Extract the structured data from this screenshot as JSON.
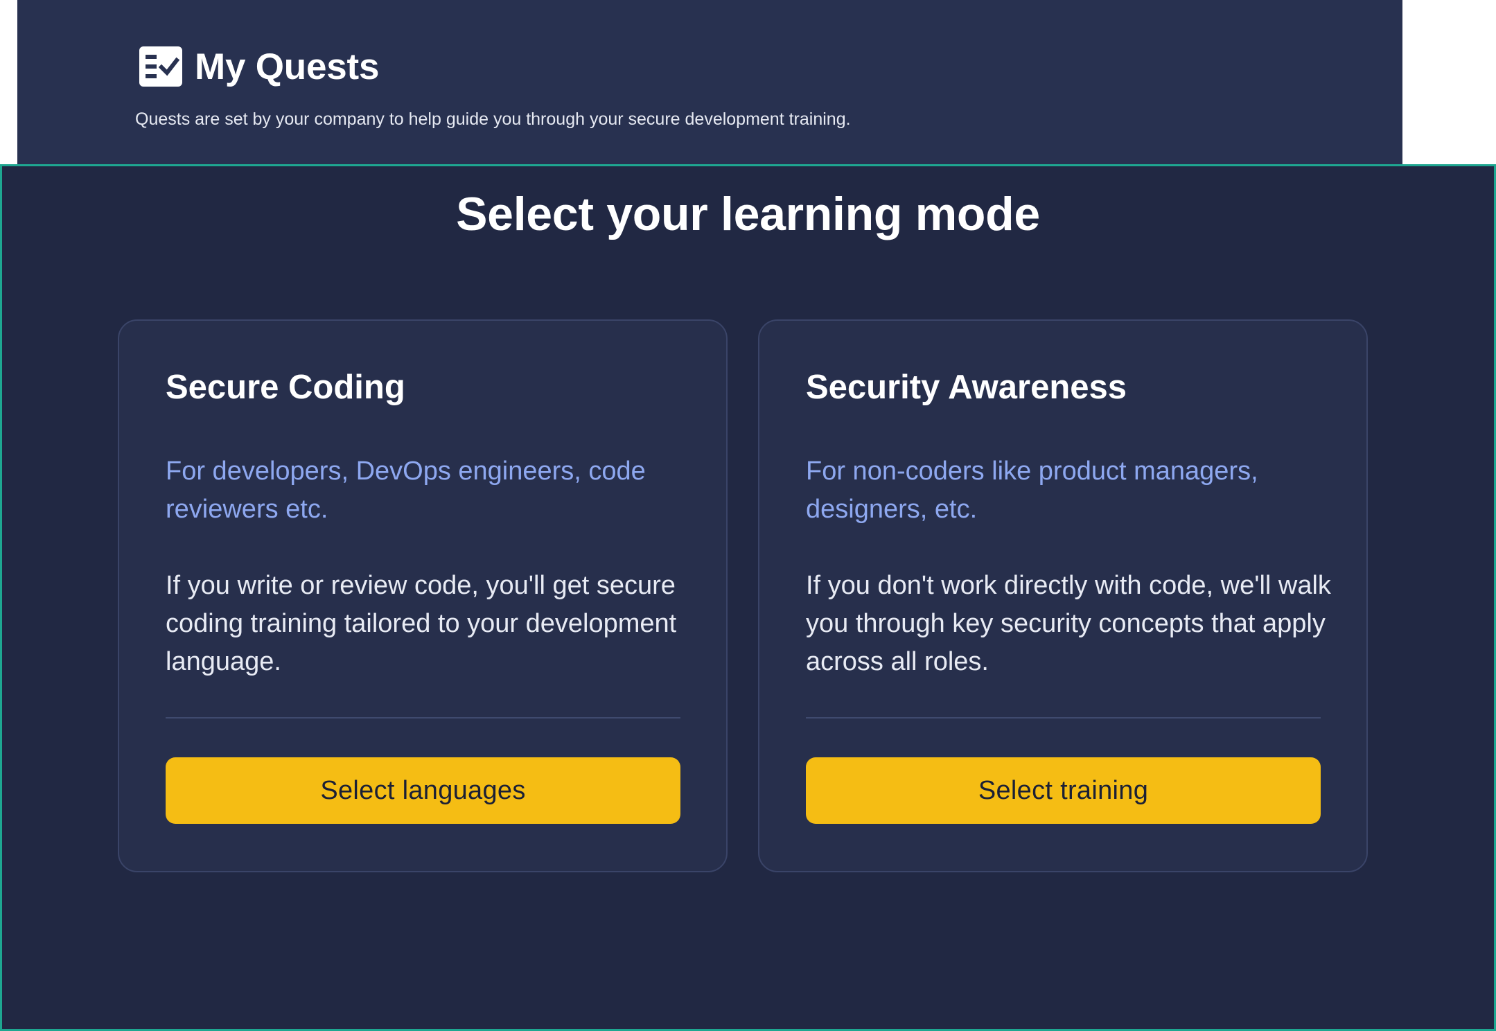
{
  "header": {
    "icon": "checklist-icon",
    "title": "My Quests",
    "subtitle": "Quests are set by your company to help guide you through your secure development training."
  },
  "modal": {
    "title": "Select your learning mode",
    "cards": [
      {
        "title": "Secure Coding",
        "audience": "For developers, DevOps engineers, code reviewers etc.",
        "description": "If you write or review code, you'll get secure coding training tailored to your development language.",
        "button_label": "Select languages"
      },
      {
        "title": "Security Awareness",
        "audience": "For non-coders like product managers, designers, etc.",
        "description": "If you don't work directly with code, we'll walk you through key security concepts that apply across all roles.",
        "button_label": "Select training"
      }
    ]
  },
  "colors": {
    "header_background": "#283150",
    "modal_background": "#212843",
    "modal_border": "#1ea791",
    "card_background": "#272f4c",
    "audience_text": "#8ea8f0",
    "button_background": "#f5bd14"
  }
}
